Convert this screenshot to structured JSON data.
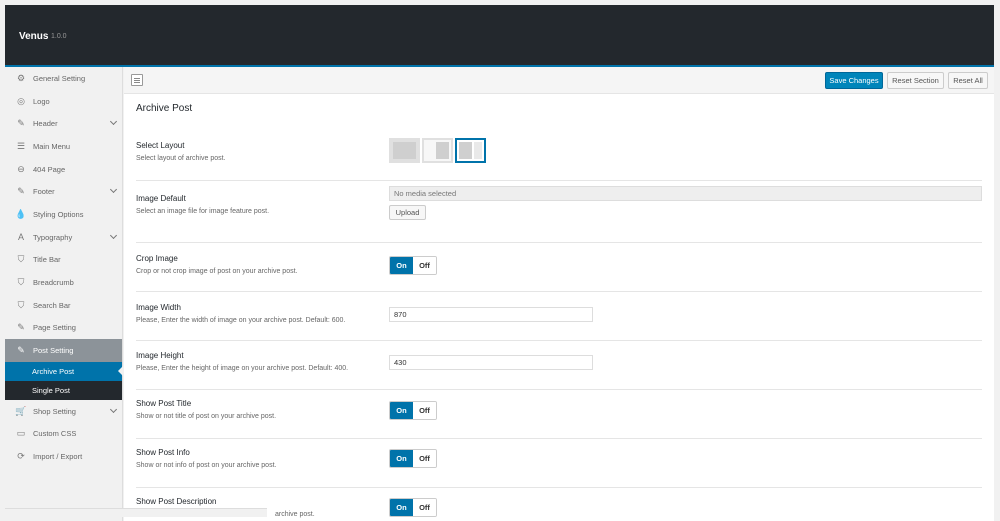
{
  "app": {
    "title": "Venus",
    "version": "1.0.0"
  },
  "sidebar": {
    "items": [
      {
        "label": "General Setting",
        "icon": "gears-icon",
        "glyph": "⚙"
      },
      {
        "label": "Logo",
        "icon": "logo-icon",
        "glyph": "◎"
      },
      {
        "label": "Header",
        "icon": "edit-icon",
        "glyph": "✎"
      },
      {
        "label": "Main Menu",
        "icon": "list-icon",
        "glyph": "☰"
      },
      {
        "label": "404 Page",
        "icon": "minus-circle-icon",
        "glyph": "⊖"
      },
      {
        "label": "Footer",
        "icon": "edit-icon",
        "glyph": "✎"
      },
      {
        "label": "Styling Options",
        "icon": "drop-icon",
        "glyph": "💧"
      },
      {
        "label": "Typography",
        "icon": "font-icon",
        "glyph": "A"
      },
      {
        "label": "Title Bar",
        "icon": "shield-icon",
        "glyph": "⛉"
      },
      {
        "label": "Breadcrumb",
        "icon": "shield-icon",
        "glyph": "⛉"
      },
      {
        "label": "Search Bar",
        "icon": "shield-icon",
        "glyph": "⛉"
      },
      {
        "label": "Page Setting",
        "icon": "edit-icon",
        "glyph": "✎"
      },
      {
        "label": "Post Setting",
        "icon": "edit-icon",
        "glyph": "✎"
      }
    ],
    "sub_items": [
      {
        "label": "Archive Post"
      },
      {
        "label": "Single Post"
      }
    ],
    "items_after": [
      {
        "label": "Shop Setting",
        "icon": "cart-icon",
        "glyph": "🛒"
      },
      {
        "label": "Custom CSS",
        "icon": "css-icon",
        "glyph": "▭"
      },
      {
        "label": "Import / Export",
        "icon": "refresh-icon",
        "glyph": "⟳"
      }
    ]
  },
  "toolbar": {
    "save_label": "Save Changes",
    "reset_section_label": "Reset Section",
    "reset_all_label": "Reset All"
  },
  "section": {
    "title": "Archive Post",
    "fields": {
      "layout": {
        "title": "Select Layout",
        "desc": "Select layout of archive post."
      },
      "image_default": {
        "title": "Image Default",
        "desc": "Select an image file for image feature post.",
        "placeholder": "No media selected",
        "upload_label": "Upload"
      },
      "crop_image": {
        "title": "Crop Image",
        "desc": "Crop or not crop image of post on your archive post.",
        "on": "On",
        "off": "Off"
      },
      "image_width": {
        "title": "Image Width",
        "desc": "Please, Enter the width of image on your archive post. Default: 600.",
        "value": "870"
      },
      "image_height": {
        "title": "Image Height",
        "desc": "Please, Enter the height of image on your archive post. Default: 400.",
        "value": "430"
      },
      "show_post_title": {
        "title": "Show Post Title",
        "desc": "Show or not title of post on your archive post.",
        "on": "On",
        "off": "Off"
      },
      "show_post_info": {
        "title": "Show Post Info",
        "desc": "Show or not info of post on your archive post.",
        "on": "On",
        "off": "Off"
      },
      "show_post_description": {
        "title": "Show Post Description",
        "desc": "archive post.",
        "on": "On",
        "off": "Off"
      }
    }
  }
}
